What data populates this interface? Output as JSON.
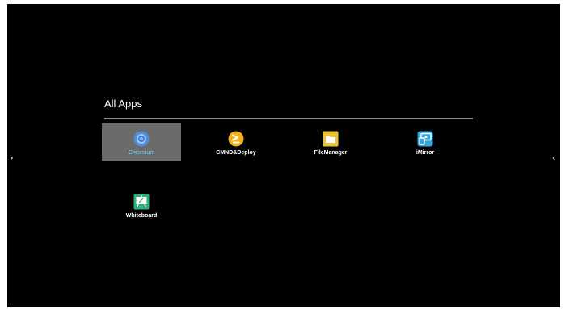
{
  "nav": {
    "left_arrow": "›",
    "right_arrow": "‹"
  },
  "section": {
    "title": "All Apps"
  },
  "apps": [
    {
      "label": "Chromium",
      "icon": "chromium-icon",
      "selected": true
    },
    {
      "label": "CMND&Deploy",
      "icon": "cmnd-deploy-icon",
      "selected": false
    },
    {
      "label": "FileManager",
      "icon": "folder-icon",
      "selected": false
    },
    {
      "label": "iMirror",
      "icon": "imirror-icon",
      "selected": false
    },
    {
      "label": "Whiteboard",
      "icon": "whiteboard-icon",
      "selected": false
    }
  ],
  "colors": {
    "background": "#000000",
    "selected_tile": "#6b6b6b",
    "selected_label": "#6fd6ff",
    "divider": "#8a8a8a"
  }
}
